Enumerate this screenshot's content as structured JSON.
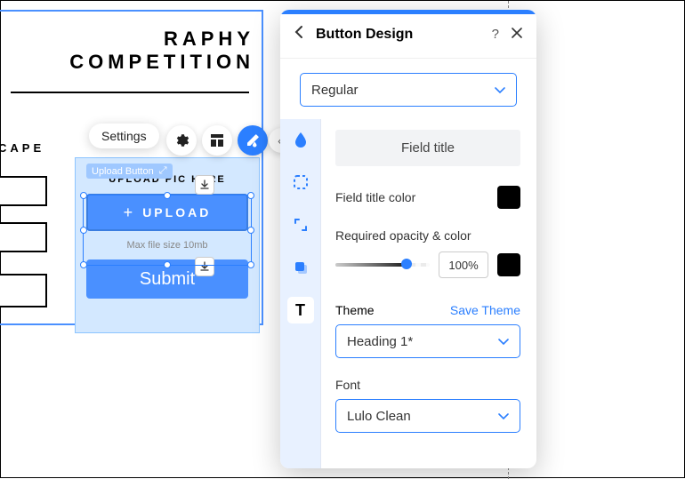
{
  "page": {
    "title": "RAPHY COMPETITION",
    "sub": "CAPE",
    "upload_tag": "Upload Button",
    "upload_label": "UPLOAD PIC HERE",
    "upload_btn": "UPLOAD",
    "max_file": "Max file size 10mb",
    "submit": "Submit"
  },
  "toolbar": {
    "settings": "Settings"
  },
  "panel": {
    "title": "Button Design",
    "state": "Regular",
    "section": "Field title",
    "field_title_color": "Field title color",
    "opacity_label": "Required opacity & color",
    "opacity_value": "100",
    "opacity_unit": "%",
    "theme_label": "Theme",
    "save_theme": "Save Theme",
    "theme_value": "Heading 1*",
    "font_label": "Font",
    "font_value": "Lulo Clean"
  }
}
